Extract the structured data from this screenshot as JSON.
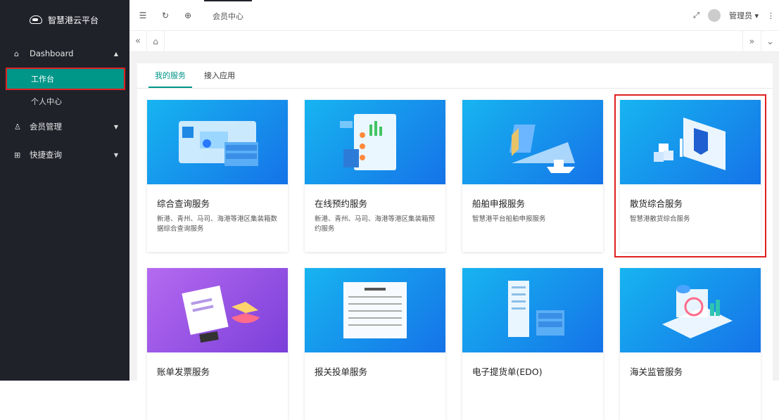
{
  "brand": {
    "title": "智慧港云平台"
  },
  "sidebar": {
    "groups": [
      {
        "label": "Dashboard",
        "items": [
          {
            "label": "工作台"
          },
          {
            "label": "个人中心"
          }
        ]
      },
      {
        "label": "会员管理"
      },
      {
        "label": "快捷查询"
      }
    ]
  },
  "topbar": {
    "tab": "会员中心",
    "user": "管理员"
  },
  "subtabs": [
    {
      "label": "我的服务"
    },
    {
      "label": "接入应用"
    }
  ],
  "cards": [
    {
      "title": "综合查询服务",
      "desc": "新港、青州、马司、海港等港区集装箱数据综合查询服务"
    },
    {
      "title": "在线预约服务",
      "desc": "新港、青州、马司、海港等港区集装箱预约服务"
    },
    {
      "title": "船舶申报服务",
      "desc": "智慧港平台船舶申报服务"
    },
    {
      "title": "散货综合服务",
      "desc": "智慧港散货综合服务"
    },
    {
      "title": "账单发票服务",
      "desc": ""
    },
    {
      "title": "报关投单服务",
      "desc": ""
    },
    {
      "title": "电子提货单(EDO)",
      "desc": ""
    },
    {
      "title": "海关监管服务",
      "desc": ""
    }
  ],
  "colors": {
    "sidebar_bg": "#20222a",
    "accent": "#009688",
    "highlight": "#e02020"
  }
}
